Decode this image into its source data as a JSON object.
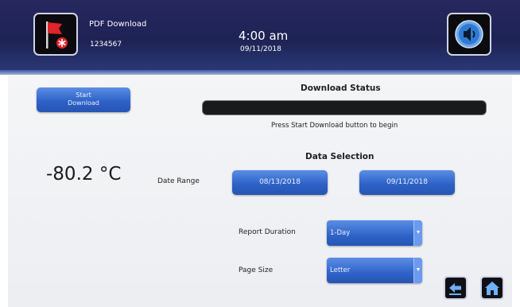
{
  "header": {
    "alarm_icon": "flag-alarm-icon",
    "title": "PDF Download",
    "serial": "1234567",
    "time": "4:00 am",
    "date": "09/11/2018",
    "sound_icon": "speaker-icon"
  },
  "download": {
    "start_label_line1": "Start",
    "start_label_line2": "Download",
    "status_title": "Download Status",
    "progress": 0,
    "status_message": "Press Start Download button to begin"
  },
  "temperature": {
    "value": "-80.2 °C"
  },
  "data_selection": {
    "title": "Data Selection",
    "date_range_label": "Date Range",
    "start_date": "08/13/2018",
    "end_date": "09/11/2018",
    "report_duration_label": "Report Duration",
    "report_duration_value": "1-Day",
    "page_size_label": "Page Size",
    "page_size_value": "Letter"
  },
  "nav": {
    "back_icon": "back-arrow-icon",
    "home_icon": "home-icon"
  },
  "colors": {
    "header_bg": "#1e2254",
    "button_blue": "#2f63c7",
    "alarm_red": "#e0252b"
  }
}
